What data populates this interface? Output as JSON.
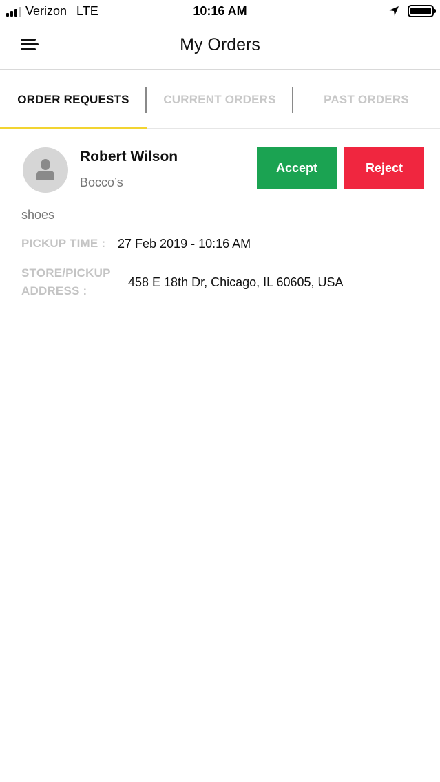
{
  "status_bar": {
    "carrier": "Verizon",
    "network": "LTE",
    "time": "10:16 AM"
  },
  "nav": {
    "title": "My Orders",
    "menu_icon": "hamburger-menu-icon"
  },
  "tabs": [
    {
      "label": "ORDER REQUESTS",
      "active": true
    },
    {
      "label": "CURRENT ORDERS",
      "active": false
    },
    {
      "label": "PAST ORDERS",
      "active": false
    }
  ],
  "colors": {
    "accent_underline": "#f2d431",
    "accept": "#1ba352",
    "reject": "#f0263f"
  },
  "order": {
    "customer_name": "Robert Wilson",
    "store_name": "Bocco’s",
    "item": "shoes",
    "pickup_time_label": "PICKUP TIME :",
    "pickup_time": "27 Feb 2019 - 10:16 AM",
    "address_label_line1": "STORE/PICKUP",
    "address_label_line2": "ADDRESS :",
    "address": "458 E 18th Dr, Chicago, IL 60605, USA",
    "accept_label": "Accept",
    "reject_label": "Reject"
  }
}
